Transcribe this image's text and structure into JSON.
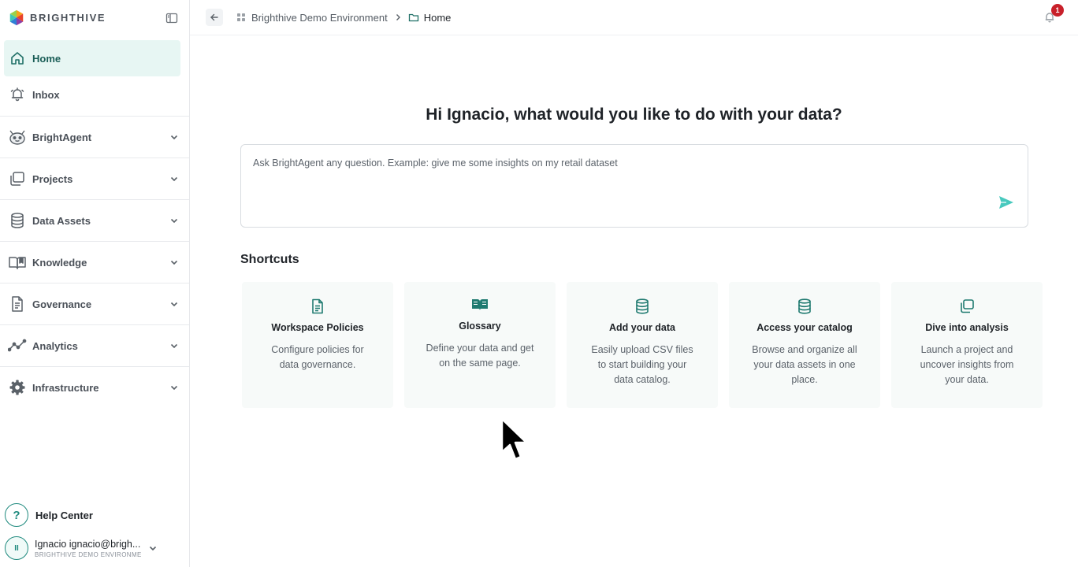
{
  "brand": {
    "name": "BRIGHTHIVE"
  },
  "sidebar": {
    "items": [
      {
        "label": "Home",
        "icon": "home-icon",
        "active": true
      },
      {
        "label": "Inbox",
        "icon": "bell-icon"
      },
      {
        "label": "BrightAgent",
        "icon": "robot-icon",
        "expandable": true
      },
      {
        "label": "Projects",
        "icon": "projects-icon",
        "expandable": true
      },
      {
        "label": "Data Assets",
        "icon": "database-icon",
        "expandable": true
      },
      {
        "label": "Knowledge",
        "icon": "book-icon",
        "expandable": true
      },
      {
        "label": "Governance",
        "icon": "document-icon",
        "expandable": true
      },
      {
        "label": "Analytics",
        "icon": "analytics-icon",
        "expandable": true
      },
      {
        "label": "Infrastructure",
        "icon": "gear-icon",
        "expandable": true
      }
    ],
    "help_label": "Help Center",
    "user": {
      "avatar_initials": "II",
      "name": "Ignacio ignacio@brigh...",
      "environment": "BRIGHTHIVE DEMO ENVIRONMENT"
    }
  },
  "topbar": {
    "breadcrumb": [
      {
        "label": "Brighthive Demo Environment",
        "icon": "grid-icon"
      },
      {
        "label": "Home",
        "icon": "folder-icon"
      }
    ],
    "notification_count": "1"
  },
  "main": {
    "greeting": "Hi Ignacio, what would you like to do with your data?",
    "prompt_placeholder": "Ask BrightAgent any question. Example: give me some insights on my retail dataset",
    "shortcuts_title": "Shortcuts",
    "shortcuts": [
      {
        "title": "Workspace Policies",
        "description": "Configure policies for data governance.",
        "icon": "policy-document-icon"
      },
      {
        "title": "Glossary",
        "description": "Define your data and get on the same page.",
        "icon": "open-book-icon"
      },
      {
        "title": "Add your data",
        "description": "Easily upload CSV files to start building your data catalog.",
        "icon": "database-icon"
      },
      {
        "title": "Access your catalog",
        "description": "Browse and organize all your data assets in one place.",
        "icon": "database-icon"
      },
      {
        "title": "Dive into analysis",
        "description": "Launch a project and uncover insights from your data.",
        "icon": "stacked-squares-icon"
      }
    ]
  },
  "colors": {
    "accent": "#1f8a7e",
    "active_bg": "#e7f6f3",
    "card_bg": "#f7faf9",
    "badge": "#c8202a",
    "send": "#48c9be"
  }
}
